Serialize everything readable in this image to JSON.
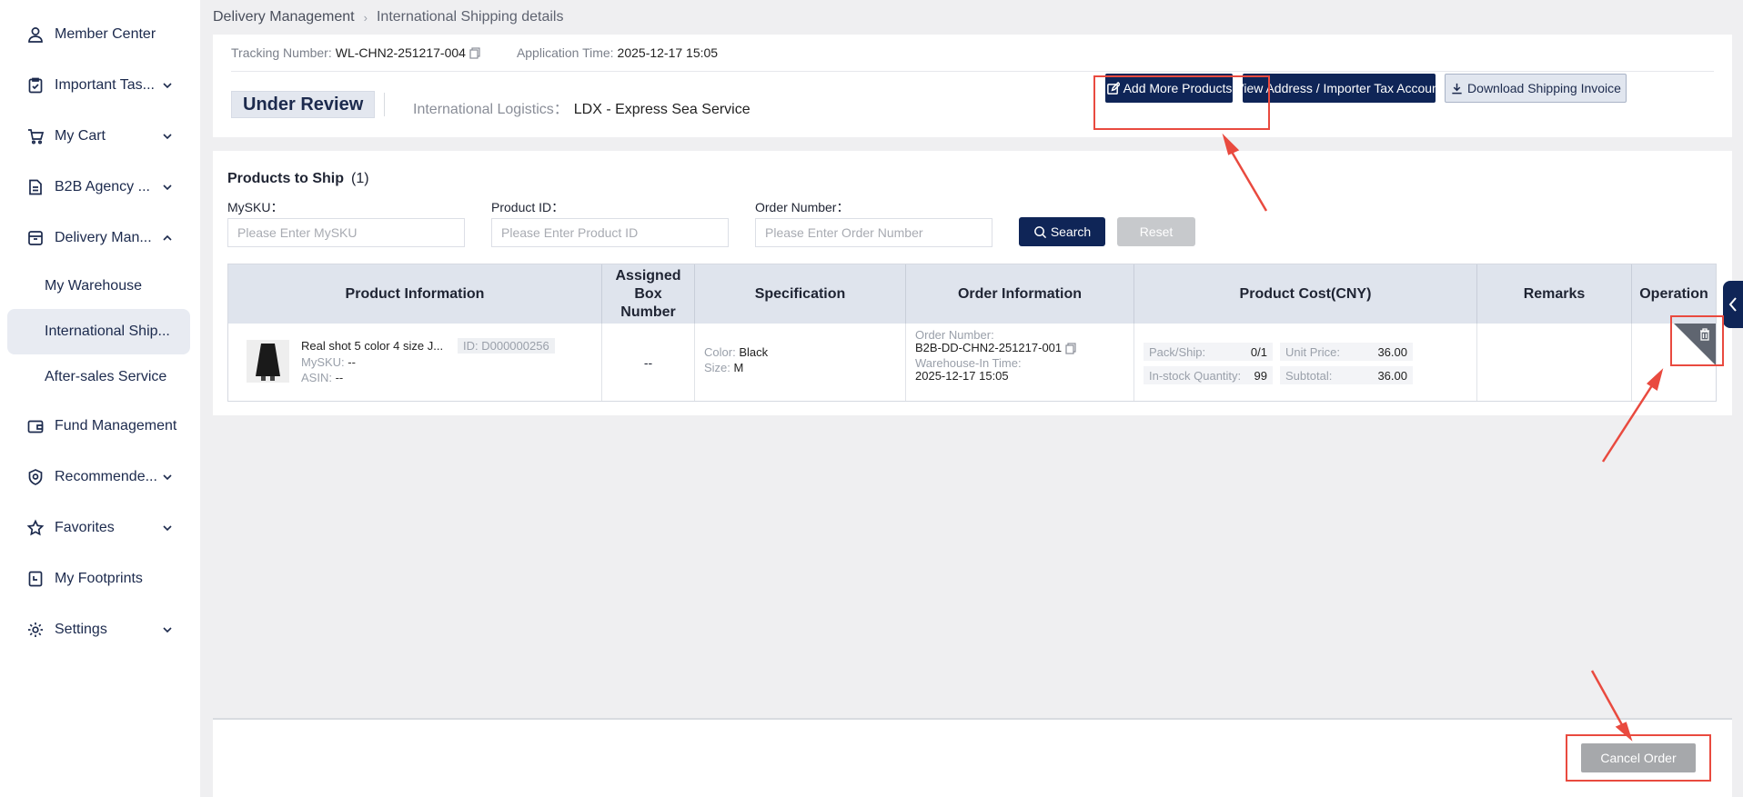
{
  "sidebar": {
    "items": [
      {
        "label": "Member Center",
        "icon": "user-icon",
        "chevron": false
      },
      {
        "label": "Important Tas...",
        "icon": "clipboard-check-icon",
        "chevron": true
      },
      {
        "label": "My Cart",
        "icon": "cart-icon",
        "chevron": true
      },
      {
        "label": "B2B Agency ...",
        "icon": "document-icon",
        "chevron": true
      },
      {
        "label": "Delivery Man...",
        "icon": "inbox-icon",
        "chevron": "up"
      },
      {
        "label": "Fund Management",
        "icon": "wallet-icon",
        "chevron": false
      },
      {
        "label": "Recommende...",
        "icon": "badge-icon",
        "chevron": true
      },
      {
        "label": "Favorites",
        "icon": "star-icon",
        "chevron": true
      },
      {
        "label": "My Footprints",
        "icon": "footprints-doc-icon",
        "chevron": false
      },
      {
        "label": "Settings",
        "icon": "gear-icon",
        "chevron": true
      }
    ],
    "subitems": [
      {
        "label": "My Warehouse",
        "active": false
      },
      {
        "label": "International Ship...",
        "active": true
      },
      {
        "label": "After-sales Service",
        "active": false
      }
    ]
  },
  "breadcrumb": {
    "parent": "Delivery Management",
    "current": "International Shipping details"
  },
  "header": {
    "tracking_label": "Tracking Number:",
    "tracking_value": "WL-CHN2-251217-004",
    "application_label": "Application Time:",
    "application_value": "2025-12-17 15:05",
    "status": "Under Review",
    "logistics_label": "International Logistics：",
    "logistics_value": "LDX - Express Sea Service",
    "add_products_label": "Add More Products",
    "view_address_label": "View Address / Importer Tax Account",
    "download_invoice_label": "Download Shipping Invoice"
  },
  "products": {
    "title": "Products to Ship",
    "count": "(1)",
    "filters": {
      "mysku_label": "MySKU：",
      "mysku_placeholder": "Please Enter MySKU",
      "product_id_label": "Product ID：",
      "product_id_placeholder": "Please Enter Product ID",
      "order_number_label": "Order Number：",
      "order_number_placeholder": "Please Enter Order Number",
      "search_label": "Search",
      "reset_label": "Reset"
    },
    "columns": [
      "Product Information",
      "Assigned Box Number",
      "Specification",
      "Order Information",
      "Product Cost(CNY)",
      "Remarks",
      "Operation"
    ],
    "rows": [
      {
        "name": "Real shot 5 color 4 size J...",
        "id": "ID: D000000256",
        "mysku_label": "MySKU:",
        "mysku": "--",
        "asin_label": "ASIN:",
        "asin": "--",
        "box": "--",
        "color_label": "Color:",
        "color": "Black",
        "size_label": "Size:",
        "size": "M",
        "order_label": "Order Number:",
        "order_number": "B2B-DD-CHN2-251217-001",
        "warehouse_label": "Warehouse-In Time:",
        "warehouse_time": "2025-12-17 15:05",
        "pack_label": "Pack/Ship:",
        "pack": "0/1",
        "unit_price_label": "Unit Price:",
        "unit_price": "36.00",
        "instock_label": "In-stock Quantity:",
        "instock": "99",
        "subtotal_label": "Subtotal:",
        "subtotal": "36.00",
        "remarks": ""
      }
    ]
  },
  "footer": {
    "cancel_label": "Cancel Order"
  },
  "colors": {
    "primary": "#0f2557",
    "annotation": "#e94a3f",
    "active_bg": "#e8ebf2"
  }
}
